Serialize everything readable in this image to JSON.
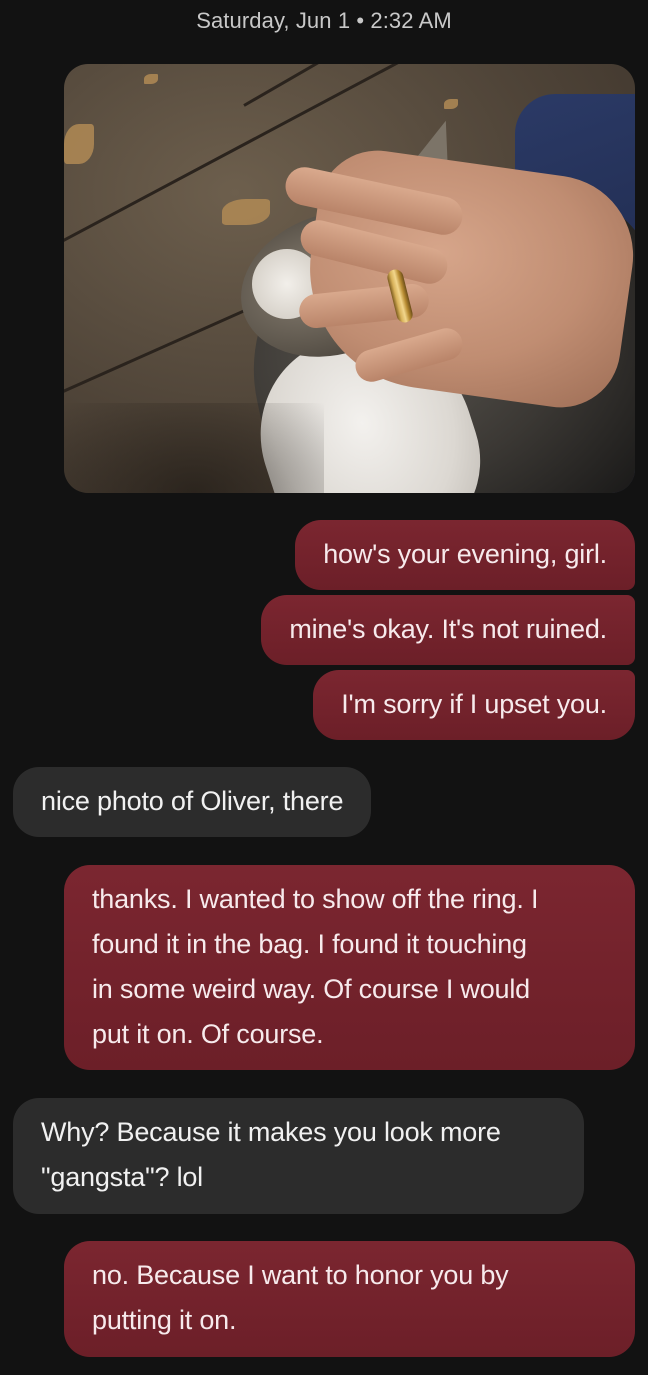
{
  "header": {
    "timestamp": "Saturday, Jun 1 • 2:32 AM"
  },
  "colors": {
    "background": "#121212",
    "sent_bubble": "#7b2630",
    "received_bubble": "#2c2c2c"
  },
  "messages": [
    {
      "direction": "sent",
      "text": "how's your evening, girl."
    },
    {
      "direction": "sent",
      "text": "mine's okay. It's not ruined."
    },
    {
      "direction": "sent",
      "text": "I'm sorry if I upset you."
    },
    {
      "direction": "received",
      "text": "nice photo of Oliver, there"
    },
    {
      "direction": "sent",
      "text": "thanks. I wanted to show off the ring. I\nfound it in the bag. I found it touching\nin some weird way. Of course I would\nput it on. Of course."
    },
    {
      "direction": "received",
      "text": "Why? Because it makes you look more\n\"gangsta\"? lol"
    },
    {
      "direction": "sent",
      "text": "no. Because I want to honor you by\nputting it on."
    }
  ]
}
